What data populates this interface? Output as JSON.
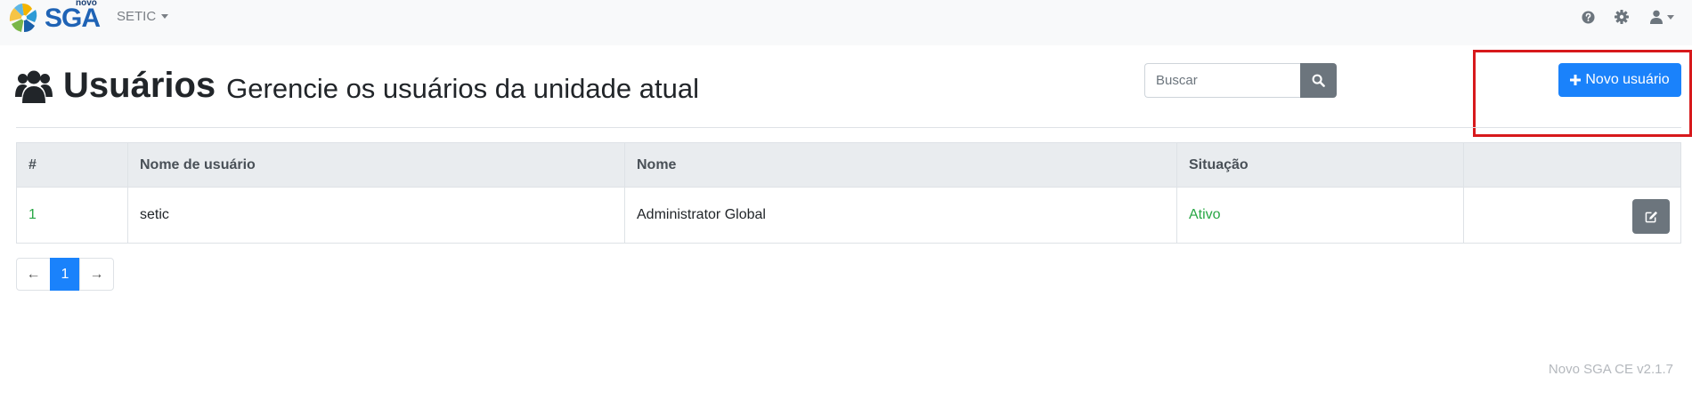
{
  "app": {
    "logo_small": "novo",
    "logo_main": "SGA",
    "unit_menu_label": "SETIC"
  },
  "header": {
    "title": "Usuários",
    "subtitle": "Gerencie os usuários da unidade atual",
    "search_placeholder": "Buscar",
    "new_user_label": "Novo usuário"
  },
  "table": {
    "columns": [
      "#",
      "Nome de usuário",
      "Nome",
      "Situação",
      ""
    ],
    "rows": [
      {
        "id": "1",
        "login": "setic",
        "name": "Administrator Global",
        "status": "Ativo"
      }
    ]
  },
  "pagination": {
    "prev": "←",
    "current": "1",
    "next": "→"
  },
  "footer": {
    "version": "Novo SGA CE v2.1.7"
  },
  "icons": {
    "help": "question-circle-icon",
    "settings": "gear-icon",
    "user": "user-icon",
    "users": "users-icon",
    "search": "search-icon",
    "edit": "edit-icon",
    "plus": "plus-icon"
  },
  "colors": {
    "primary": "#1a82fb",
    "secondary": "#6c757d",
    "success": "#28a745",
    "highlight": "#d7191c",
    "navbar_bg": "#f8f9fa"
  }
}
